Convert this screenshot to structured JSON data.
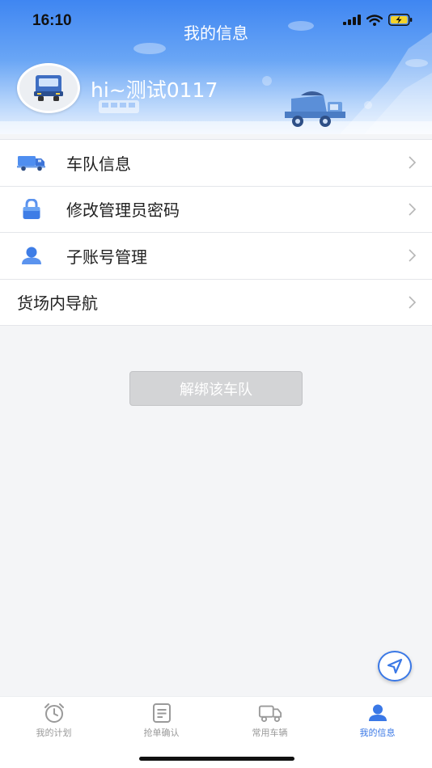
{
  "status_bar": {
    "time": "16:10"
  },
  "header": {
    "title": "我的信息",
    "username": "hi~测试0117"
  },
  "menu": {
    "items": [
      {
        "label": "车队信息",
        "icon": "truck-icon"
      },
      {
        "label": "修改管理员密码",
        "icon": "lock-icon"
      },
      {
        "label": "子账号管理",
        "icon": "user-icon"
      },
      {
        "label": "货场内导航",
        "icon": ""
      }
    ]
  },
  "actions": {
    "unbind_label": "解绑该车队"
  },
  "tabbar": {
    "tabs": [
      {
        "label": "我的计划",
        "icon": "alarm-clock-icon",
        "active": false
      },
      {
        "label": "抢单确认",
        "icon": "document-icon",
        "active": false
      },
      {
        "label": "常用车辆",
        "icon": "truck-outline-icon",
        "active": false
      },
      {
        "label": "我的信息",
        "icon": "person-icon",
        "active": true
      }
    ]
  },
  "colors": {
    "accent": "#3a78e6",
    "header_top": "#3f86f2",
    "tab_inactive": "#9a9a9a",
    "button_disabled": "#d3d4d6"
  }
}
